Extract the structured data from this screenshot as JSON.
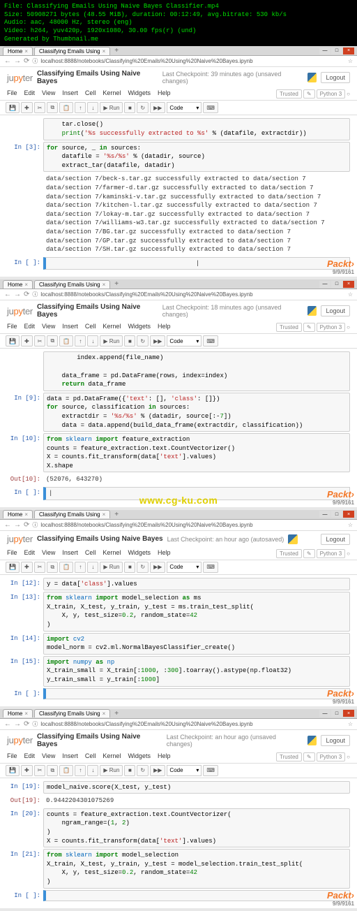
{
  "video_info": {
    "file": "File: Classifying Emails Using Naive Bayes Classifier.mp4",
    "size": "Size: 50908271 bytes (48.55 MiB), duration: 00:12:49, avg.bitrate: 530 kb/s",
    "audio": "Audio: aac, 48000 Hz, stereo (eng)",
    "video": "Video: h264, yuv420p, 1920x1080, 30.00 fps(r) (und)",
    "generated": "Generated by Thumbnail.me"
  },
  "tabs": {
    "t1": "Home",
    "t2": "Classifying Emails Using"
  },
  "url": "localhost:8888/notebooks/Classifying%20Emails%20Using%20Naive%20Bayes.ipynb",
  "logo": {
    "ju": "ju",
    "py": "py",
    "ter": "ter"
  },
  "nbname": "Classifying Emails Using Naive Bayes",
  "checkpoint": {
    "p1": "Last Checkpoint: 39 minutes ago  (unsaved changes)",
    "p2": "Last Checkpoint: 18 minutes ago  (unsaved changes)",
    "p3": "Last Checkpoint: an hour ago  (autosaved)",
    "p4": "Last Checkpoint: an hour ago  (unsaved changes)"
  },
  "logout": "Logout",
  "menu": {
    "file": "File",
    "edit": "Edit",
    "view": "View",
    "insert": "Insert",
    "cell": "Cell",
    "kernel": "Kernel",
    "widgets": "Widgets",
    "help": "Help"
  },
  "trusted": {
    "label": "Trusted",
    "kernel": "Python 3",
    "pencil": "✎",
    "circle": "○"
  },
  "tool": {
    "save": "💾",
    "add": "✚",
    "cut": "✂",
    "copy": "⧉",
    "paste": "📋",
    "up": "↑",
    "down": "↓",
    "run": "▶ Run",
    "stop": "■",
    "restart": "↻",
    "ff": "▶▶",
    "celltype": "Code",
    "kbd": "⌨"
  },
  "watermark": "Packt›",
  "watermark_tail": "9/9/9161",
  "cg": "www.cg-ku.com",
  "pane1": {
    "in_label": "In [3]:",
    "code_top": "    tar.close()\n    print('%s successfully extracted to %s' % (datafile, extractdir))",
    "code_main": "for source, _ in sources:\n    datafile = '%s/%s' % (datadir, source)\n    extract_tar(datafile, datadir)",
    "out_text": "data/section 7/beck-s.tar.gz successfully extracted to data/section 7\ndata/section 7/farmer-d.tar.gz successfully extracted to data/section 7\ndata/section 7/kaminski-v.tar.gz successfully extracted to data/section 7\ndata/section 7/kitchen-l.tar.gz successfully extracted to data/section 7\ndata/section 7/lokay-m.tar.gz successfully extracted to data/section 7\ndata/section 7/williams-w3.tar.gz successfully extracted to data/section 7\ndata/section 7/BG.tar.gz successfully extracted to data/section 7\ndata/section 7/GP.tar.gz successfully extracted to data/section 7\ndata/section 7/SH.tar.gz successfully extracted to data/section 7",
    "empty": "In [ ]:",
    "caret": "|"
  },
  "pane2": {
    "frag_top": "        index.append(file_name)\n\n    data_frame = pd.DataFrame(rows, index=index)\n    return data_frame",
    "in9": "In [9]:",
    "code9": "data = pd.DataFrame({'text': [], 'class': []})\nfor source, classification in sources:\n    extractdir = '%s/%s' % (datadir, source[:-7])\n    data = data.append(build_data_frame(extractdir, classification))",
    "in10": "In [10]:",
    "code10": "from sklearn import feature_extraction\ncounts = feature_extraction.text.CountVectorizer()\nX = counts.fit_transform(data['text'].values)\nX.shape",
    "out10": "Out[10]:",
    "out10_val": "(52076, 643270)",
    "empty": "In [ ]:",
    "caret": "|"
  },
  "pane3": {
    "in12": "In [12]:",
    "code12": "y = data['class'].values",
    "in13": "In [13]:",
    "code13": "from sklearn import model_selection as ms\nX_train, X_test, y_train, y_test = ms.train_test_split(\n    X, y, test_size=0.2, random_state=42\n)",
    "in14": "In [14]:",
    "code14": "import cv2\nmodel_norm = cv2.ml.NormalBayesClassifier_create()",
    "in15": "In [15]:",
    "code15": "import numpy as np\nX_train_small = X_train[:1000, :300].toarray().astype(np.float32)\ny_train_small = y_train[:1000]",
    "empty": "In [ ]:"
  },
  "pane4": {
    "in19": "In [19]:",
    "code19": "model_naive.score(X_test, y_test)",
    "out19": "Out[19]:",
    "out19_val": "0.9442204301075269",
    "in20": "In [20]:",
    "code20": "counts = feature_extraction.text.CountVectorizer(\n    ngram_range=(1, 2)\n)\nX = counts.fit_transform(data['text'].values)",
    "in21": "In [21]:",
    "code21": "from sklearn import model_selection\nX_train, X_test, y_train, y_test = model_selection.train_test_split(\n    X, y, test_size=0.2, random_state=42\n)",
    "empty": "In [ ]:"
  }
}
